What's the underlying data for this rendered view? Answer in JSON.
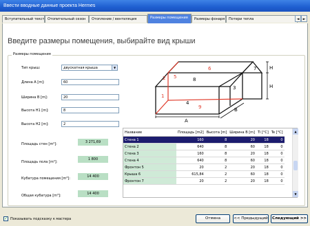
{
  "window": {
    "title": "Ввести вводные данные проекта Hermes"
  },
  "tabs": [
    {
      "label": "Вступительный текст"
    },
    {
      "label": "Отопительный сезон"
    },
    {
      "label": "Отопление / вентиляция"
    },
    {
      "label": "Размеры помещения",
      "active": true
    },
    {
      "label": "Размеры фонаря"
    },
    {
      "label": "Потери тепла"
    }
  ],
  "tab_nav": {
    "prev_icon": "chevron-left-icon",
    "next_icon": "chevron-right-icon",
    "prev": "◄",
    "next": "►"
  },
  "page": {
    "heading": "Введите размеры помещения, выбирайте вид крыши",
    "group_title": "Размеры помещения"
  },
  "form": {
    "roof_type": {
      "label": "Тип крыш:",
      "value": "двускатная крыша",
      "arrow": "▼"
    },
    "length_a": {
      "label": "Длина A [m]:",
      "value": "60"
    },
    "width_b": {
      "label": "Ширина B [m]:",
      "value": "20"
    },
    "height_h1": {
      "label": "Высота H1 [m]:",
      "value": "8"
    },
    "height_h2": {
      "label": "Высота H2 [m]:",
      "value": "2"
    }
  },
  "results": {
    "wall_area": {
      "label": "Площадь стен [m²]:",
      "value": "3 271,69"
    },
    "floor_area": {
      "label": "Площадь пола [m²]:",
      "value": "1 800"
    },
    "room_volume": {
      "label": "Кубатура помещения [m³]:",
      "value": "14 400"
    },
    "total_volume": {
      "label": "Общая кубатура [m³]:",
      "value": "14 400"
    }
  },
  "diagram": {
    "labels": {
      "A": "A",
      "B": "B",
      "H1": "H",
      "H2": "H",
      "n1": "1",
      "n2": "2",
      "n3": "3",
      "n4": "4",
      "n5": "5",
      "n6": "6",
      "n7": "7",
      "n8": "8",
      "n9": "9"
    }
  },
  "table": {
    "columns": [
      "Название",
      "Площадь [m2]",
      "Высота [m]",
      "Ширина B [m]",
      "Ti [°C]",
      "Te [°C]"
    ],
    "rows": [
      [
        "Стена 1",
        "160",
        "8",
        "20",
        "18",
        "0"
      ],
      [
        "Стена 2",
        "640",
        "8",
        "60",
        "18",
        "0"
      ],
      [
        "Стена 3",
        "160",
        "8",
        "20",
        "18",
        "0"
      ],
      [
        "Стена 4",
        "640",
        "8",
        "60",
        "18",
        "0"
      ],
      [
        "Фронтон 5",
        "20",
        "2",
        "20",
        "18",
        "0"
      ],
      [
        "Крыша 6",
        "615,84",
        "2",
        "60",
        "18",
        "0"
      ],
      [
        "Фронтон 7",
        "20",
        "2",
        "20",
        "18",
        "0"
      ]
    ],
    "selected_row": 0,
    "scroll_up": "▲",
    "scroll_down": "▼"
  },
  "footer": {
    "checkbox_label": "Показывать подсказку к мастера",
    "checkbox_checked": true,
    "check_mark": "✓",
    "cancel": "Отмена",
    "prev": "<< Предыдущий",
    "next": "Следующий >>"
  },
  "colors": {
    "title_bar": "#1f5fd1",
    "active_tab": "#4f82e0",
    "readonly_fill": "#b9dfc4",
    "diagram_red": "#e03a2a",
    "selected_row": "#1c1c6e"
  }
}
